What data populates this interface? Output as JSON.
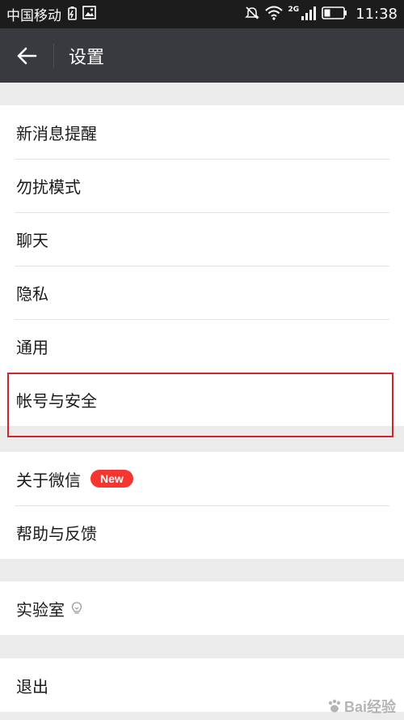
{
  "status_bar": {
    "carrier": "中国移动",
    "network": "2G",
    "time": "11:38"
  },
  "header": {
    "title": "设置"
  },
  "groups": [
    {
      "items": [
        {
          "label": "新消息提醒"
        },
        {
          "label": "勿扰模式"
        },
        {
          "label": "聊天"
        },
        {
          "label": "隐私"
        },
        {
          "label": "通用"
        },
        {
          "label": "帐号与安全"
        }
      ]
    },
    {
      "items": [
        {
          "label": "关于微信",
          "badge": "New"
        },
        {
          "label": "帮助与反馈"
        }
      ]
    },
    {
      "items": [
        {
          "label": "实验室",
          "icon": "bulb-icon"
        }
      ]
    },
    {
      "items": [
        {
          "label": "退出"
        }
      ]
    }
  ],
  "watermark": {
    "text": "Bai经验"
  },
  "colors": {
    "header_bg": "#393a3f",
    "status_bg": "#1c1c1c",
    "badge": "#f43530",
    "highlight": "#d2242b",
    "page_bg": "#ebebeb"
  },
  "icons": [
    "battery-saver-icon",
    "image-icon",
    "mute-icon",
    "wifi-icon",
    "signal-icon",
    "battery-icon",
    "back-arrow-icon",
    "bulb-icon"
  ]
}
